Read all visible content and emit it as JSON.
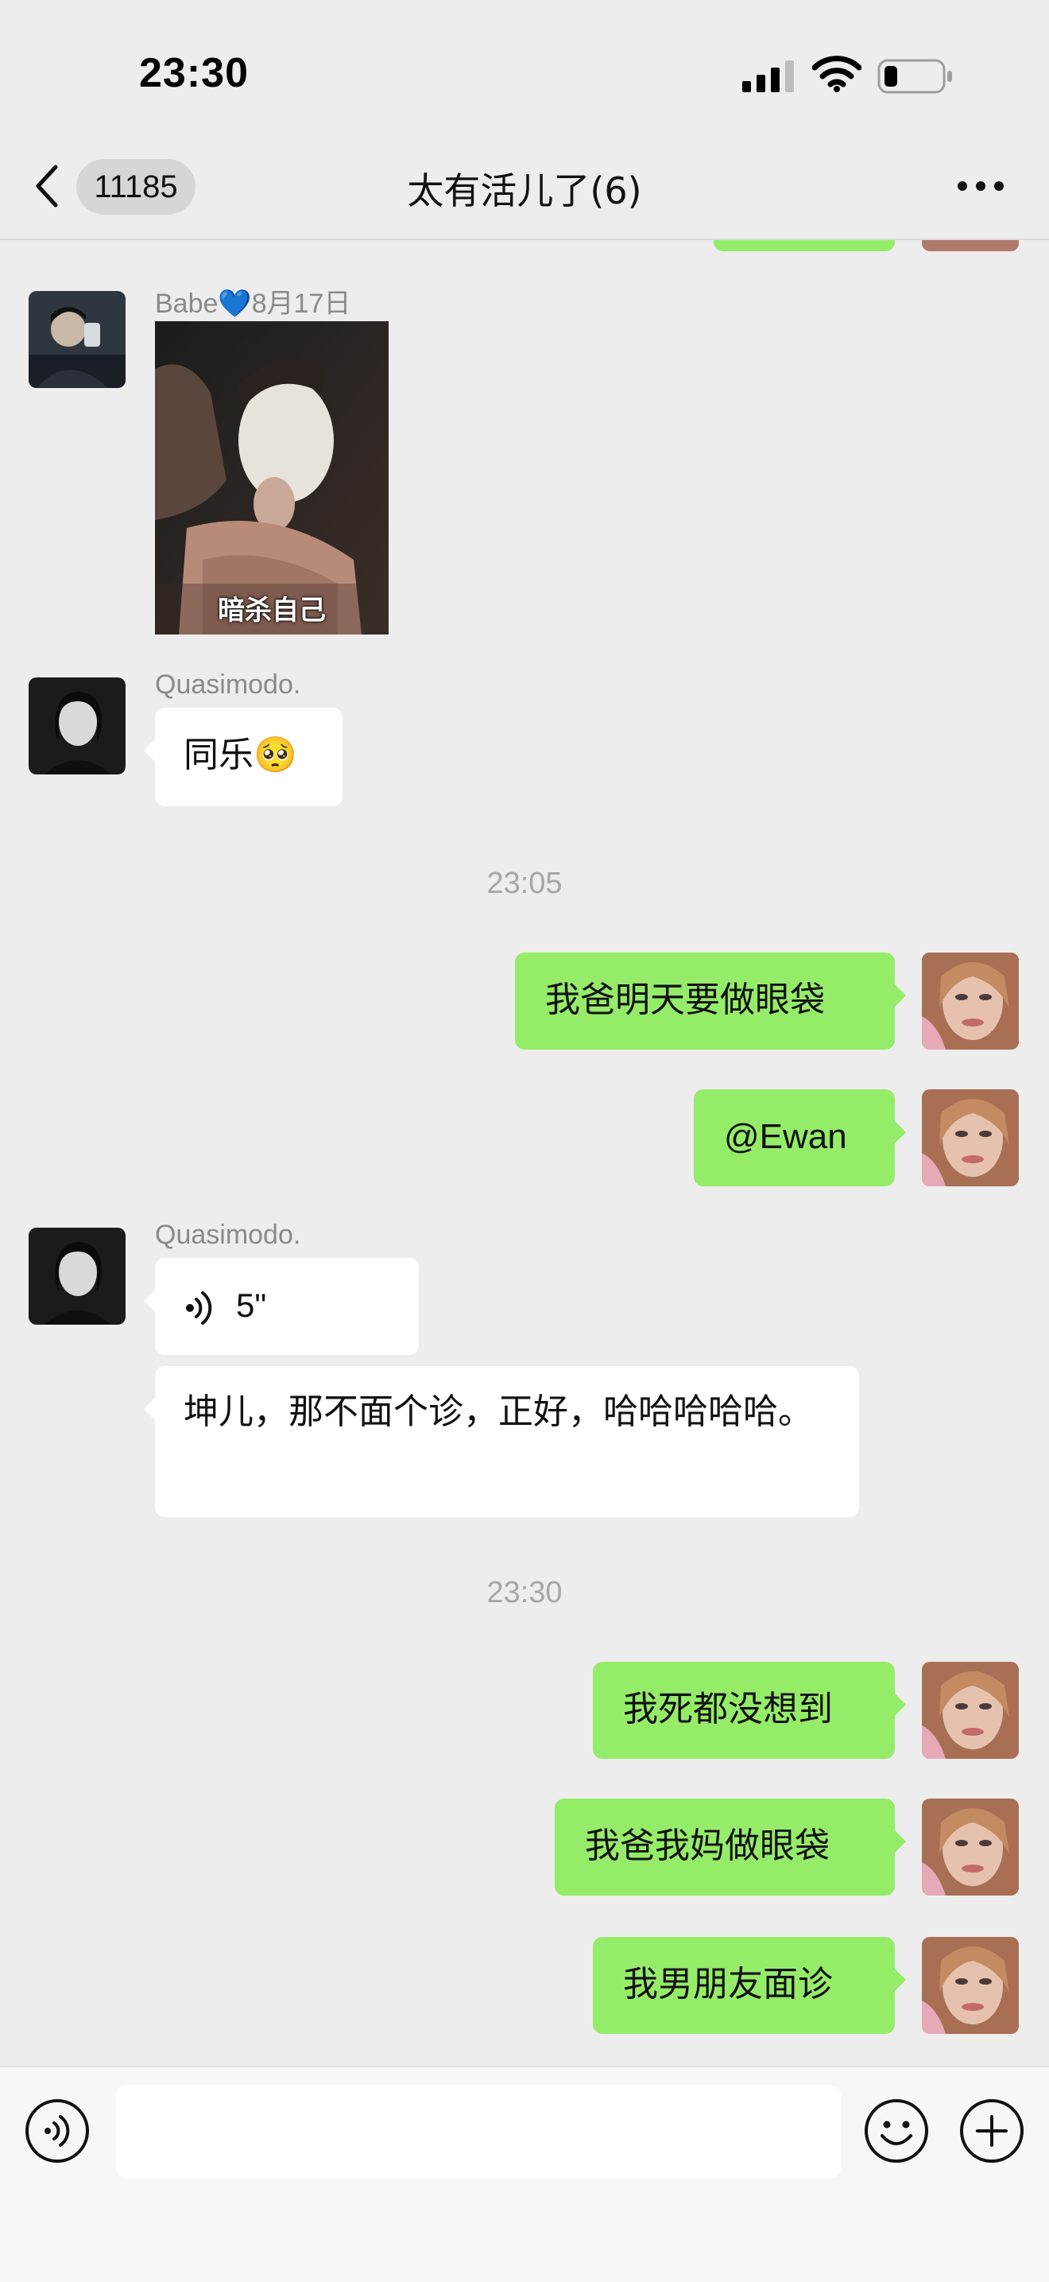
{
  "status_bar": {
    "time": "23:30"
  },
  "nav": {
    "unread_count": "11185",
    "title": "太有活儿了(6)"
  },
  "messages": {
    "m1_sender": "Babe💙8月17日",
    "m1_image_caption": "暗杀自己",
    "m2_sender": "Quasimodo.",
    "m2_text": "同乐🥺",
    "ts1": "23:05",
    "m3_text": "我爸明天要做眼袋",
    "m4_text": "@Ewan",
    "m5_sender": "Quasimodo.",
    "m5_voice_duration": "5\"",
    "m6_text": "坤儿，那不面个诊，正好，哈哈哈哈哈。",
    "ts2": "23:30",
    "m7_text": "我死都没想到",
    "m8_text": "我爸我妈做眼袋",
    "m9_text": "我男朋友面诊"
  },
  "input": {
    "placeholder": ""
  },
  "colors": {
    "sent_bubble": "#95ec69",
    "received_bubble": "#ffffff",
    "background": "#ededed"
  },
  "icons": {
    "back": "chevron-left-icon",
    "more": "more-dots-icon",
    "voice": "voice-icon",
    "emoji": "emoji-icon",
    "add": "plus-icon",
    "signal": "signal-icon",
    "wifi": "wifi-icon",
    "battery": "battery-icon"
  }
}
